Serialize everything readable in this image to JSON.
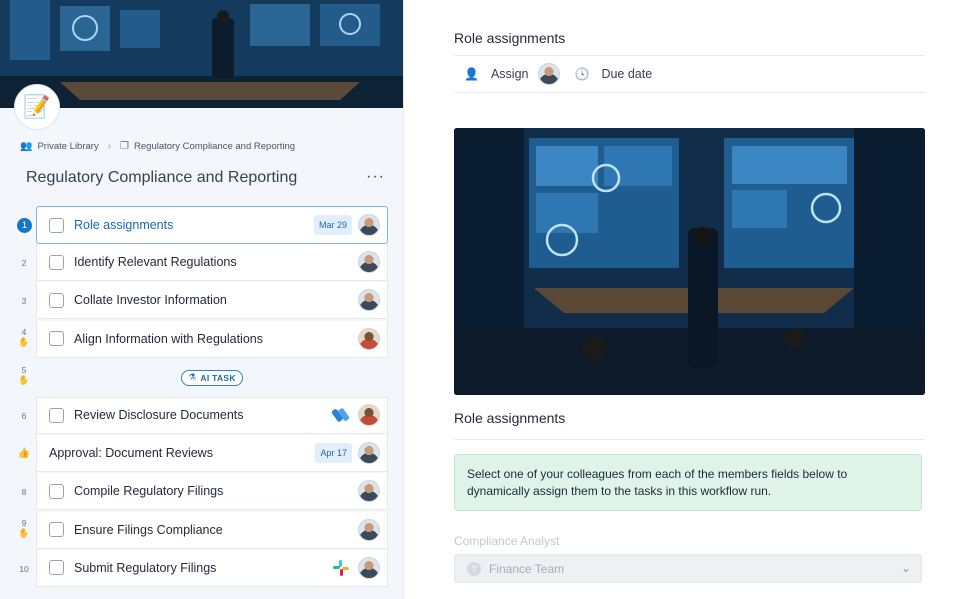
{
  "sidebar": {
    "breadcrumb": {
      "library": "Private Library",
      "template": "Regulatory Compliance and Reporting"
    },
    "title": "Regulatory Compliance and Reporting",
    "more": "···",
    "ai_task_label": "AI TASK",
    "tasks": [
      {
        "num": "1",
        "label": "Role assignments",
        "date": "Mar 29"
      },
      {
        "num": "2",
        "label": "Identify Relevant Regulations"
      },
      {
        "num": "3",
        "label": "Collate Investor Information"
      },
      {
        "num": "4",
        "label": "Align Information with Regulations"
      },
      {
        "num": "5"
      },
      {
        "num": "6",
        "label": "Review Disclosure Documents"
      },
      {
        "num": "",
        "label": "Approval: Document Reviews",
        "date": "Apr 17"
      },
      {
        "num": "8",
        "label": "Compile Regulatory Filings"
      },
      {
        "num": "9",
        "label": "Ensure Filings Compliance"
      },
      {
        "num": "10",
        "label": "Submit Regulatory Filings"
      }
    ]
  },
  "main": {
    "title": "Role assignments",
    "assign_label": "Assign",
    "due_label": "Due date",
    "section_heading": "Role assignments",
    "info_text": "Select one of your colleagues from each of the members fields below to dynamically assign them to the tasks in this workflow run.",
    "field_label": "Compliance Analyst",
    "field_value": "Finance Team"
  },
  "colors": {
    "accent": "#1677c9",
    "info_bg": "#dff3e8"
  }
}
